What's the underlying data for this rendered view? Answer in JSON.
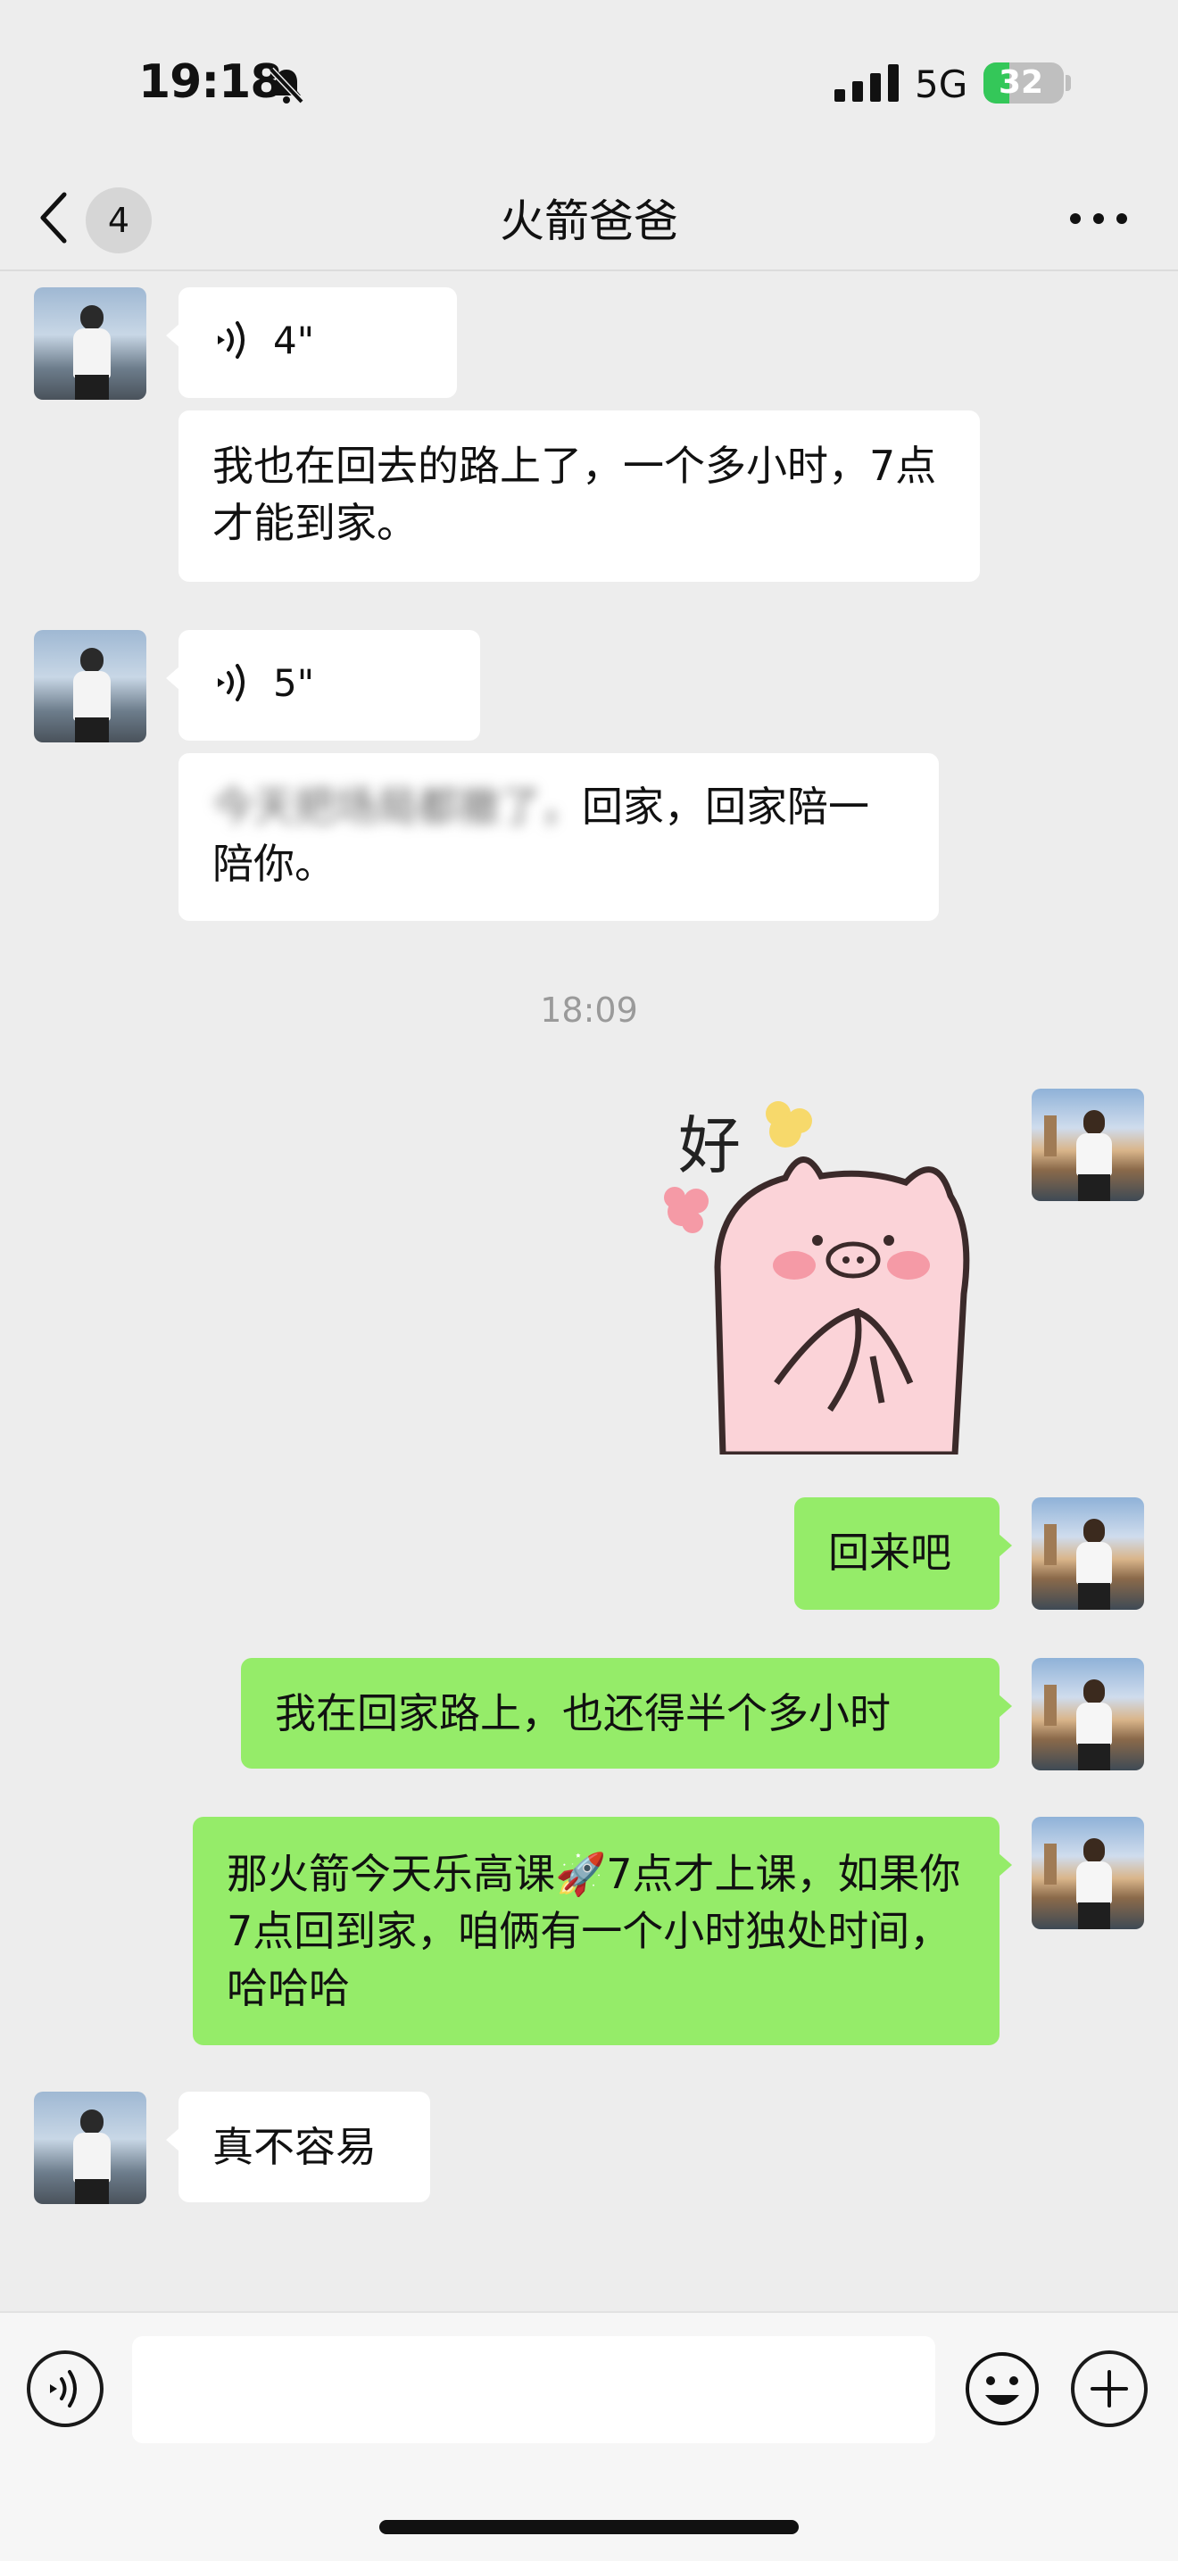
{
  "status_bar": {
    "time": "19:18",
    "network": "5G",
    "battery_level": "32",
    "battery_fraction": 0.32
  },
  "nav": {
    "back_count": "4",
    "title": "火箭爸爸"
  },
  "messages": [
    {
      "type": "voice",
      "direction": "in",
      "duration": "4\""
    },
    {
      "type": "text",
      "direction": "in",
      "text": "我也在回去的路上了，一个多小时，7点才能到家。"
    },
    {
      "type": "voice",
      "direction": "in",
      "duration": "5\""
    },
    {
      "type": "text",
      "direction": "in",
      "text_visible": "回家，回家陪一陪你。",
      "text_obscured": "今天把场局都撤了，"
    },
    {
      "type": "timestamp",
      "text": "18:09"
    },
    {
      "type": "sticker",
      "direction": "out",
      "text": "好"
    },
    {
      "type": "text",
      "direction": "out",
      "text": "回来吧"
    },
    {
      "type": "text",
      "direction": "out",
      "text": "我在回家路上，也还得半个多小时"
    },
    {
      "type": "text",
      "direction": "out",
      "text": "那火箭今天乐高课🚀7点才上课，如果你7点回到家，咱俩有一个小时独处时间，哈哈哈"
    },
    {
      "type": "text",
      "direction": "in",
      "text": "真不容易"
    }
  ],
  "input_bar": {
    "placeholder": ""
  },
  "icons": {
    "back": "chevron-left-icon",
    "more": "more-dots-icon",
    "voice": "voice-wave-icon",
    "emoji": "smiley-icon",
    "plus": "plus-icon",
    "mute": "bell-slash-icon",
    "signal": "cellular-signal-icon",
    "battery": "battery-icon"
  },
  "colors": {
    "incoming_bubble": "#ffffff",
    "outgoing_bubble": "#95ec69",
    "background": "#ededed",
    "battery_fill": "#34c759"
  }
}
